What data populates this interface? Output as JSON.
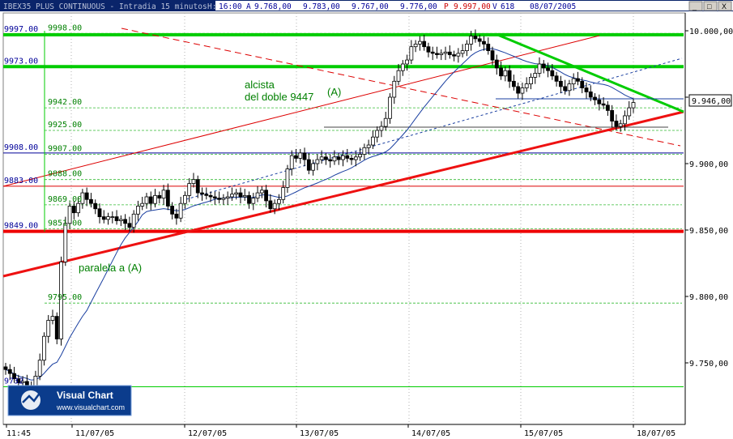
{
  "header": {
    "symbol": "IBEX35 PLUS CONTINUOUS - Intradia 15 minutos",
    "h_key": "H:",
    "time": "16:00",
    "a_key": "A",
    "open": "9.768,00",
    "high": "9.783,00",
    "low": "9.767,00",
    "close": "9.776,00",
    "p_key": "P",
    "p_value": "9.997,00",
    "v_key": "V",
    "volume": "618",
    "date": "08/07/2005"
  },
  "window_buttons": [
    "_",
    "□",
    "X"
  ],
  "logo": {
    "title": "Visual Chart",
    "url": "www.visualchart.com"
  },
  "colors": {
    "green": "#00cc00",
    "red": "#dd0000",
    "blue": "#000099",
    "navy_ma": "#1a3fa0",
    "text_green": "#008000"
  },
  "chart_data": {
    "type": "candlestick",
    "ylim": [
      9700,
      10050
    ],
    "y_ticks": [
      {
        "v": 10000,
        "label": "10.000,00"
      },
      {
        "v": 9950,
        "label": "9.950,00"
      },
      {
        "v": 9900,
        "label": "9.900,00"
      },
      {
        "v": 9850,
        "label": "9.850,00"
      },
      {
        "v": 9800,
        "label": "9.800,00"
      },
      {
        "v": 9750,
        "label": "9.750,00"
      }
    ],
    "last_price": "9.946,00",
    "x_ticks": [
      "11:45",
      "11/07/05",
      "12/07/05",
      "13/07/05",
      "14/07/05",
      "15/07/05",
      "18/07/05"
    ],
    "levels": [
      {
        "v": 9997,
        "label": "9997.00",
        "color": "#00cc00",
        "style": "thick"
      },
      {
        "v": 9973,
        "label": "9973.00",
        "color": "#00cc00",
        "style": "thick"
      },
      {
        "v": 9908,
        "label": "9908.00",
        "color": "#000099",
        "style": "thin"
      },
      {
        "v": 9883,
        "label": "9883.00",
        "color": "#dd0000",
        "style": "thin"
      },
      {
        "v": 9849,
        "label": "9849.00",
        "color": "#ee0000",
        "style": "thick"
      },
      {
        "v": 9732,
        "label": "9732",
        "color": "#00cc00",
        "style": "thin"
      }
    ],
    "retracements": [
      {
        "v": 9998,
        "label": "9998.00"
      },
      {
        "v": 9942,
        "label": "9942.00"
      },
      {
        "v": 9925,
        "label": "9925.00"
      },
      {
        "v": 9907,
        "label": "9907.00"
      },
      {
        "v": 9888,
        "label": "9888.00"
      },
      {
        "v": 9869,
        "label": "9869.00"
      },
      {
        "v": 9851,
        "label": "9851.00"
      },
      {
        "v": 9795,
        "label": "9795.00"
      }
    ],
    "annotations": [
      "alcista",
      "del doble 9447",
      "(A)",
      "paralela a (A)"
    ],
    "series": {
      "close": [
        9745,
        9742,
        9738,
        9735,
        9736,
        9733,
        9730,
        9740,
        9752,
        9770,
        9782,
        9785,
        9768,
        9826,
        9855,
        9868,
        9863,
        9870,
        9878,
        9873,
        9870,
        9866,
        9860,
        9858,
        9860,
        9860,
        9857,
        9858,
        9855,
        9852,
        9862,
        9868,
        9870,
        9875,
        9870,
        9876,
        9874,
        9880,
        9868,
        9862,
        9859,
        9870,
        9876,
        9885,
        9888,
        9878,
        9877,
        9876,
        9875,
        9874,
        9873,
        9874,
        9875,
        9877,
        9878,
        9875,
        9876,
        9870,
        9874,
        9878,
        9880,
        9872,
        9866,
        9870,
        9873,
        9882,
        9896,
        9906,
        9904,
        9908,
        9903,
        9895,
        9900,
        9903,
        9905,
        9903,
        9902,
        9905,
        9903,
        9906,
        9904,
        9903,
        9905,
        9907,
        9912,
        9914,
        9920,
        9925,
        9928,
        9934,
        9950,
        9962,
        9970,
        9975,
        9978,
        9988,
        9990,
        9992,
        9988,
        9984,
        9983,
        9982,
        9983,
        9984,
        9982,
        9981,
        9983,
        9985,
        9990,
        9996,
        9994,
        9992,
        9990,
        9985,
        9978,
        9972,
        9966,
        9970,
        9962,
        9958,
        9953,
        9957,
        9960,
        9965,
        9968,
        9975,
        9972,
        9970,
        9966,
        9962,
        9958,
        9955,
        9960,
        9964,
        9962,
        9957,
        9954,
        9950,
        9948,
        9945,
        9944,
        9940,
        9932,
        9928,
        9930,
        9936,
        9942,
        9946
      ]
    }
  }
}
